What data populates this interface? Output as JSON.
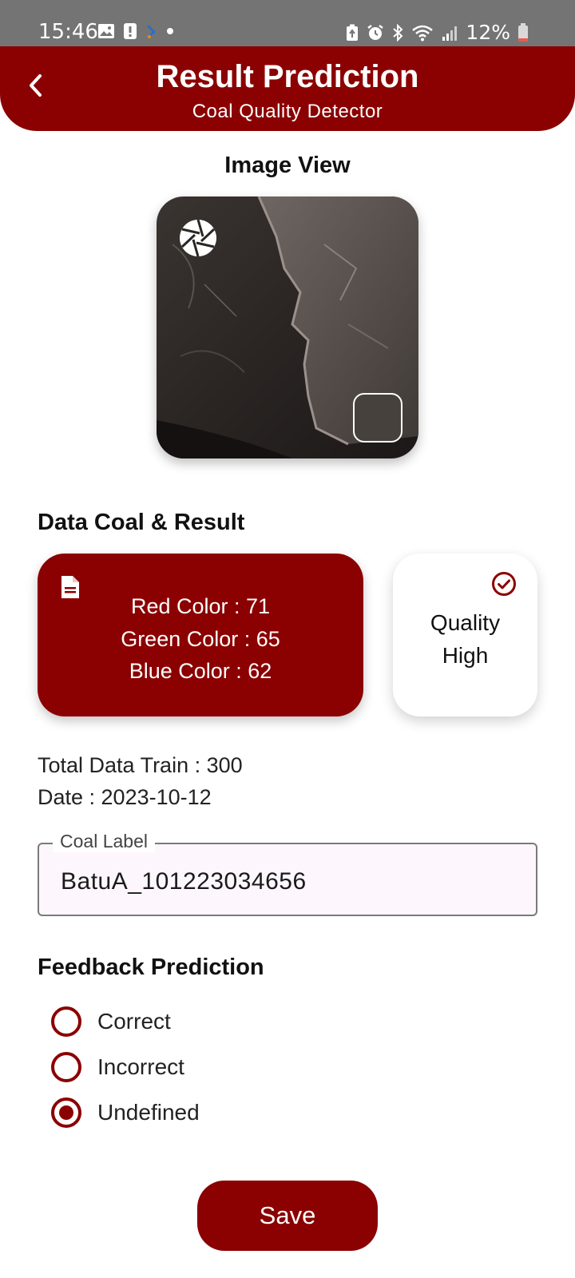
{
  "status_bar": {
    "time": "15:46",
    "battery": "12%",
    "left_icons": [
      "gallery-icon",
      "alert-icon",
      "app-icon",
      "dot-icon"
    ],
    "right_icons": [
      "battery-saver-icon",
      "alarm-icon",
      "bluetooth-icon",
      "wifi-icon",
      "signal-icon",
      "battery-icon"
    ]
  },
  "header": {
    "title": "Result Prediction",
    "subtitle": "Coal Quality Detector",
    "back_icon": "chevron-left-icon"
  },
  "image_section": {
    "title": "Image View",
    "swatch_color": "#47413e"
  },
  "data_section": {
    "title": "Data Coal & Result",
    "rgb": {
      "red": "Red Color : 71",
      "green": "Green Color : 65",
      "blue": "Blue Color : 62"
    },
    "quality": {
      "line1": "Quality",
      "line2": "High"
    }
  },
  "info": {
    "total_train": "Total Data Train : 300",
    "date": "Date : 2023-10-12"
  },
  "coal_label": {
    "label": "Coal Label",
    "value": "BatuA_101223034656"
  },
  "feedback": {
    "title": "Feedback Prediction",
    "options": [
      {
        "label": "Correct",
        "selected": false
      },
      {
        "label": "Incorrect",
        "selected": false
      },
      {
        "label": "Undefined",
        "selected": true
      }
    ]
  },
  "save_button": "Save",
  "colors": {
    "accent": "#8b0000",
    "status_bar": "#747474"
  }
}
